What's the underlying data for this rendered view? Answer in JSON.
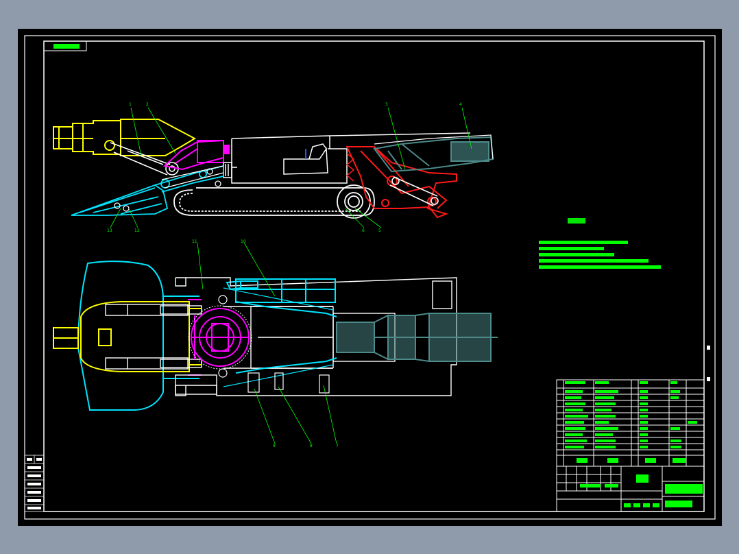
{
  "drawing": {
    "background": "#000000",
    "frame_color": "#ffffff",
    "colors": {
      "yellow": "#ffff00",
      "magenta": "#ff00ff",
      "cyan": "#00e5ff",
      "red": "#ff1a1a",
      "teal": "#4d8a8a",
      "white": "#ffffff",
      "green": "#00ff00",
      "blue": "#2255ff"
    },
    "top_left_tag": "",
    "side_view_callouts": [
      "1",
      "2",
      "3",
      "4",
      "5",
      "6",
      "12",
      "13"
    ],
    "plan_view_callouts": [
      "7",
      "8",
      "9",
      "10",
      "11"
    ],
    "tech_requirements_title": "",
    "tech_requirements": [],
    "title_block": {
      "title": "",
      "drawing_no": "",
      "company": ""
    },
    "side_stamp": [],
    "revision_mark": "",
    "revision_stamp": ""
  }
}
